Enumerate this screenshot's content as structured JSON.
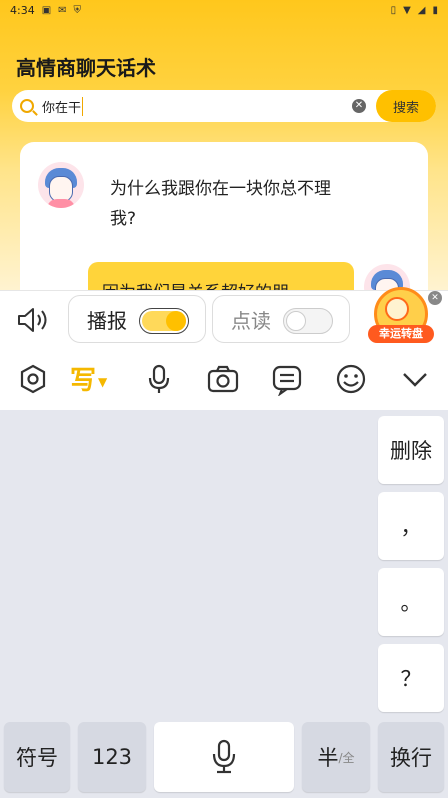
{
  "status_bar": {
    "time": "4:34",
    "left_icons": [
      "notification-a-icon",
      "notification-b-icon",
      "shield-icon"
    ],
    "right_icons": [
      "vibrate-icon",
      "wifi-icon",
      "signal-icon",
      "battery-icon"
    ]
  },
  "app": {
    "title": "高情商聊天话术",
    "search": {
      "value": "你在干",
      "button_label": "搜索"
    },
    "chat": [
      {
        "side": "left",
        "text": "为什么我跟你在一块你总不理我?"
      },
      {
        "side": "right",
        "text": "因为我们是关系超好的朋"
      }
    ]
  },
  "toolbar": {
    "broadcast_label": "播报",
    "broadcast_on": true,
    "read_label": "点读",
    "read_on": false,
    "lucky_wheel_label": "幸运转盘"
  },
  "ime_bar": {
    "write_label": "写",
    "icons": [
      "settings-hex-icon",
      "write-icon",
      "microphone-icon",
      "camera-icon",
      "clipboard-icon",
      "emoji-icon",
      "collapse-icon"
    ]
  },
  "keyboard": {
    "delete_label": "删除",
    "comma": "，",
    "period": "。",
    "question": "？",
    "symbols_label": "符号",
    "numbers_label": "123",
    "half_label": "半",
    "full_label": "/全",
    "enter_label": "换行"
  },
  "colors": {
    "accent": "#ffc000",
    "header_top": "#ffc71c"
  }
}
